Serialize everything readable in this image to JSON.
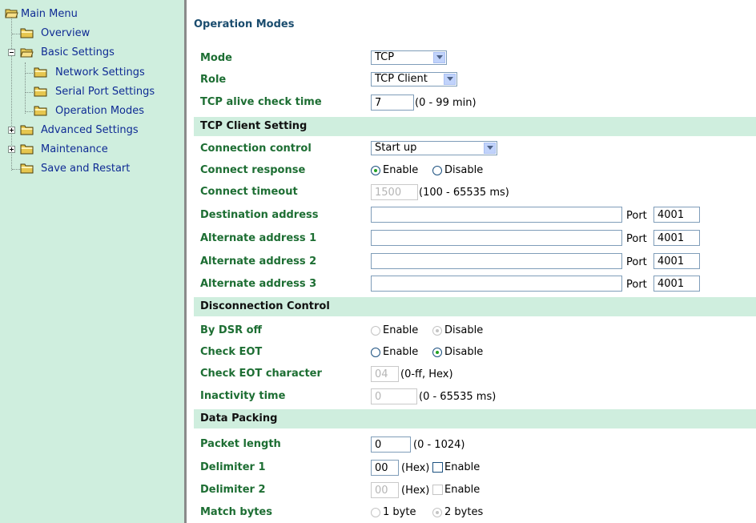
{
  "sidebar": {
    "root": "Main Menu",
    "items": [
      {
        "label": "Overview"
      },
      {
        "label": "Basic Settings"
      },
      {
        "label": "Network Settings"
      },
      {
        "label": "Serial Port Settings"
      },
      {
        "label": "Operation Modes"
      },
      {
        "label": "Advanced Settings"
      },
      {
        "label": "Maintenance"
      },
      {
        "label": "Save and Restart"
      }
    ]
  },
  "page": {
    "title": "Operation Modes"
  },
  "general": {
    "mode_label": "Mode",
    "mode_value": "TCP",
    "role_label": "Role",
    "role_value": "TCP Client",
    "alive_label": "TCP alive check time",
    "alive_value": "7",
    "alive_hint": "(0 - 99 min)"
  },
  "tcp_client": {
    "section": "TCP Client Setting",
    "conn_control_label": "Connection control",
    "conn_control_value": "Start up",
    "conn_response_label": "Connect response",
    "enable": "Enable",
    "disable": "Disable",
    "conn_timeout_label": "Connect timeout",
    "conn_timeout_value": "1500",
    "conn_timeout_hint": "(100 - 65535 ms)",
    "port_label": "Port",
    "addresses": [
      {
        "label": "Destination address",
        "value": "",
        "port": "4001"
      },
      {
        "label": "Alternate address 1",
        "value": "",
        "port": "4001"
      },
      {
        "label": "Alternate address 2",
        "value": "",
        "port": "4001"
      },
      {
        "label": "Alternate address 3",
        "value": "",
        "port": "4001"
      }
    ]
  },
  "disconnect": {
    "section": "Disconnection Control",
    "dsr_label": "By DSR off",
    "eot_label": "Check EOT",
    "eot_char_label": "Check EOT character",
    "eot_char_value": "04",
    "eot_char_hint": "(0-ff, Hex)",
    "inactivity_label": "Inactivity time",
    "inactivity_value": "0",
    "inactivity_hint": "(0 - 65535 ms)"
  },
  "packing": {
    "section": "Data Packing",
    "packet_label": "Packet length",
    "packet_value": "0",
    "packet_hint": "(0 - 1024)",
    "delim1_label": "Delimiter 1",
    "delim1_value": "00",
    "delim2_label": "Delimiter 2",
    "delim2_value": "00",
    "hex": "(Hex)",
    "enable": "Enable",
    "match_label": "Match bytes",
    "one_byte": "1 byte",
    "two_bytes": "2 bytes"
  },
  "colors": {
    "sidebar_bg": "#cfeede",
    "section_bg": "#cfeede",
    "label_green": "#1d6e33",
    "link_blue": "#0f2b94"
  },
  "icons": [
    "folder-open-icon",
    "folder-icon",
    "plus-toggle-icon",
    "minus-toggle-icon",
    "dropdown-arrow-icon"
  ]
}
